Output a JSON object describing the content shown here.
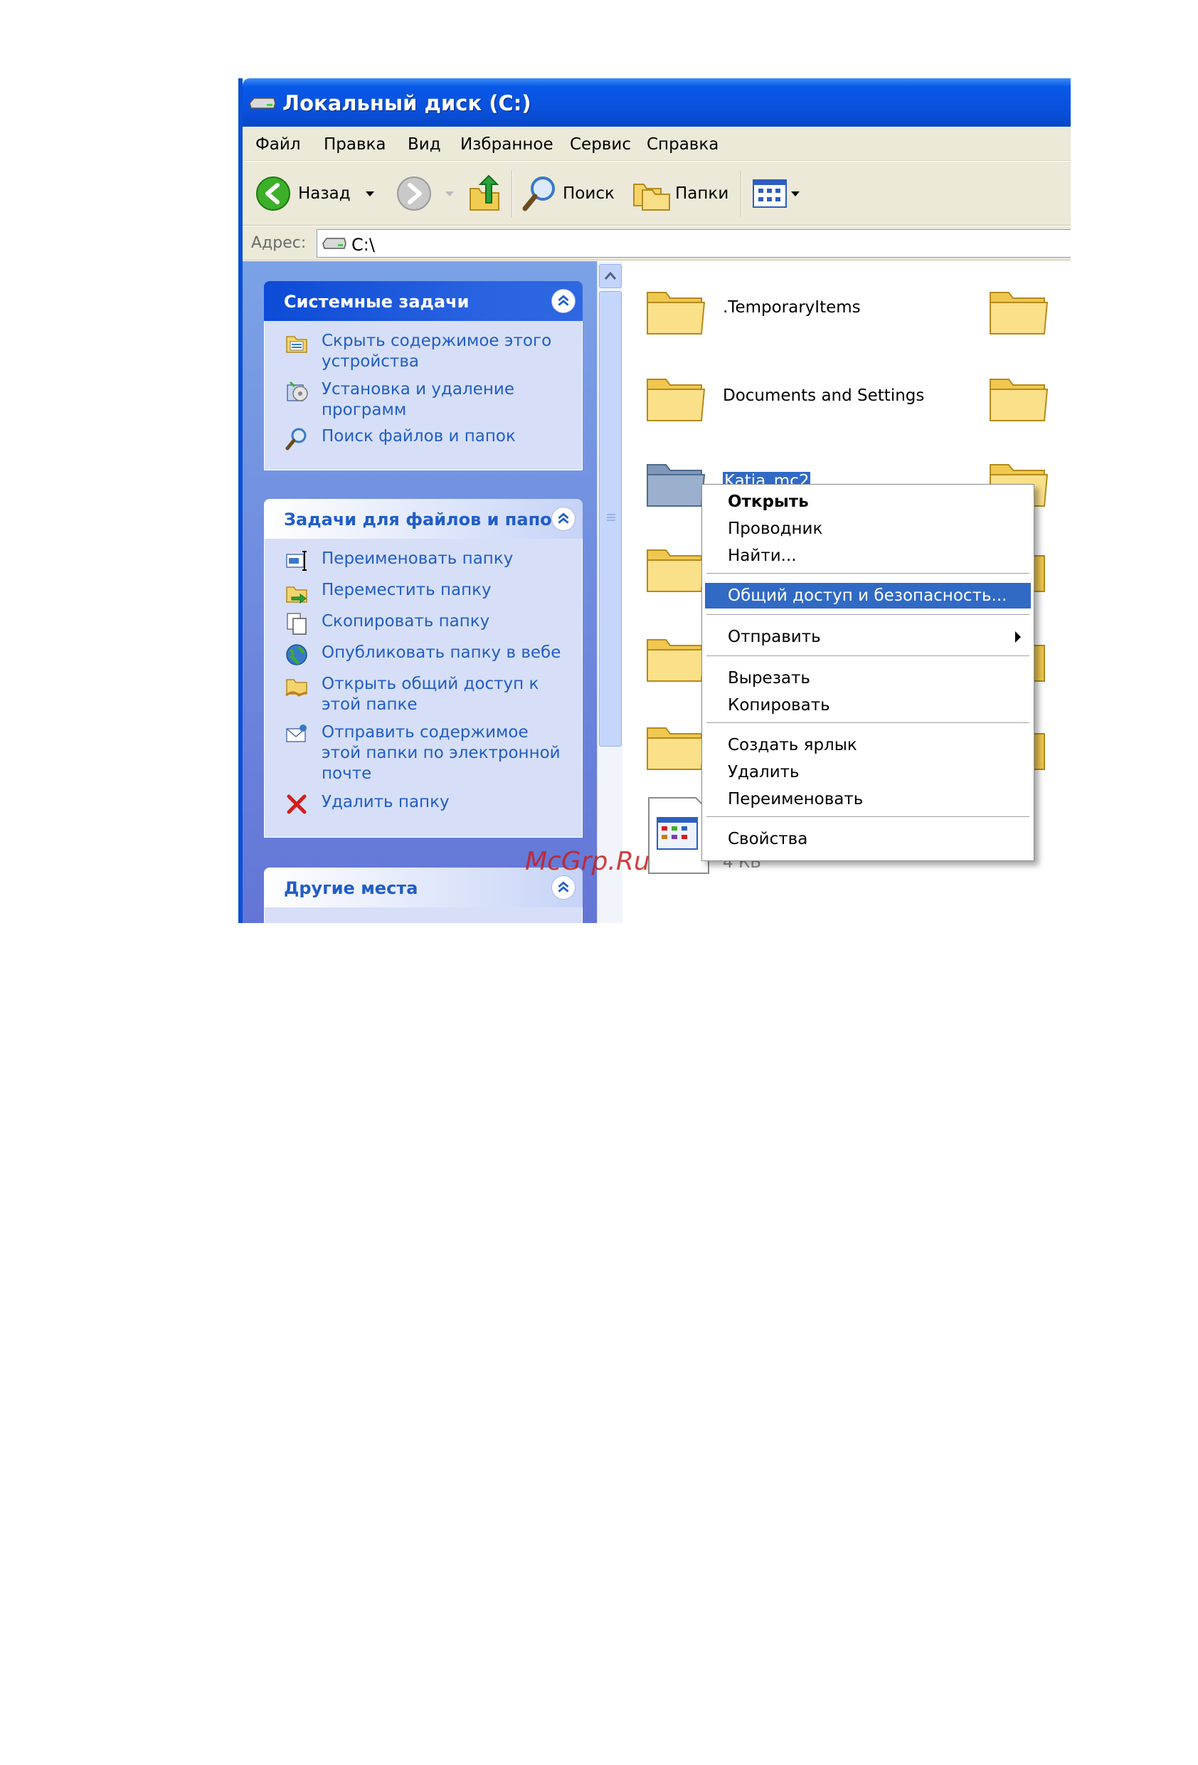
{
  "window": {
    "title": "Локальный диск (C:)"
  },
  "menubar": [
    "Файл",
    "Правка",
    "Вид",
    "Избранное",
    "Сервис",
    "Справка"
  ],
  "toolbar": {
    "back": "Назад",
    "search": "Поиск",
    "folders": "Папки"
  },
  "address": {
    "label": "Адрес:",
    "value": "C:\\"
  },
  "system_tasks": {
    "title": "Системные задачи",
    "items": [
      {
        "lines": [
          "Скрыть содержимое этого",
          "устройства"
        ],
        "icon": "hide-contents-icon"
      },
      {
        "lines": [
          "Установка и удаление",
          "программ"
        ],
        "icon": "add-remove-programs-icon"
      },
      {
        "lines": [
          "Поиск файлов и папок"
        ],
        "icon": "search-icon"
      }
    ]
  },
  "file_tasks": {
    "title": "Задачи для файлов и папок",
    "items": [
      {
        "lines": [
          "Переименовать папку"
        ],
        "icon": "rename-icon"
      },
      {
        "lines": [
          "Переместить папку"
        ],
        "icon": "move-icon"
      },
      {
        "lines": [
          "Скопировать папку"
        ],
        "icon": "copy-icon"
      },
      {
        "lines": [
          "Опубликовать папку в вебе"
        ],
        "icon": "globe-icon"
      },
      {
        "lines": [
          "Открыть общий доступ к",
          "этой папке"
        ],
        "icon": "share-folder-icon"
      },
      {
        "lines": [
          "Отправить содержимое",
          "этой папки по электронной",
          "почте"
        ],
        "icon": "email-icon"
      },
      {
        "lines": [
          "Удалить папку"
        ],
        "icon": "delete-icon"
      }
    ]
  },
  "other_places": {
    "title": "Другие места"
  },
  "files": [
    {
      "name": ".TemporaryItems"
    },
    {
      "name": "Documents and Settings"
    },
    {
      "name": "Katja_mc2"
    }
  ],
  "context_menu": {
    "items": [
      {
        "label": "Открыть",
        "bold": true
      },
      {
        "label": "Проводник"
      },
      {
        "label": "Найти..."
      },
      {
        "label": "Общий доступ и безопасность...",
        "highlighted": true
      },
      {
        "label": "Отправить",
        "submenu": true
      },
      {
        "label": "Вырезать"
      },
      {
        "label": "Копировать"
      },
      {
        "label": "Создать ярлык"
      },
      {
        "label": "Удалить"
      },
      {
        "label": "Переименовать"
      },
      {
        "label": "Свойства"
      }
    ]
  },
  "file_size": "4 КБ",
  "watermark": "McGrp.Ru",
  "colors": {
    "titlebar": "#0a52dd",
    "taskpane": "#6f8fe0",
    "highlight": "#316ac5",
    "link": "#215dc6"
  }
}
